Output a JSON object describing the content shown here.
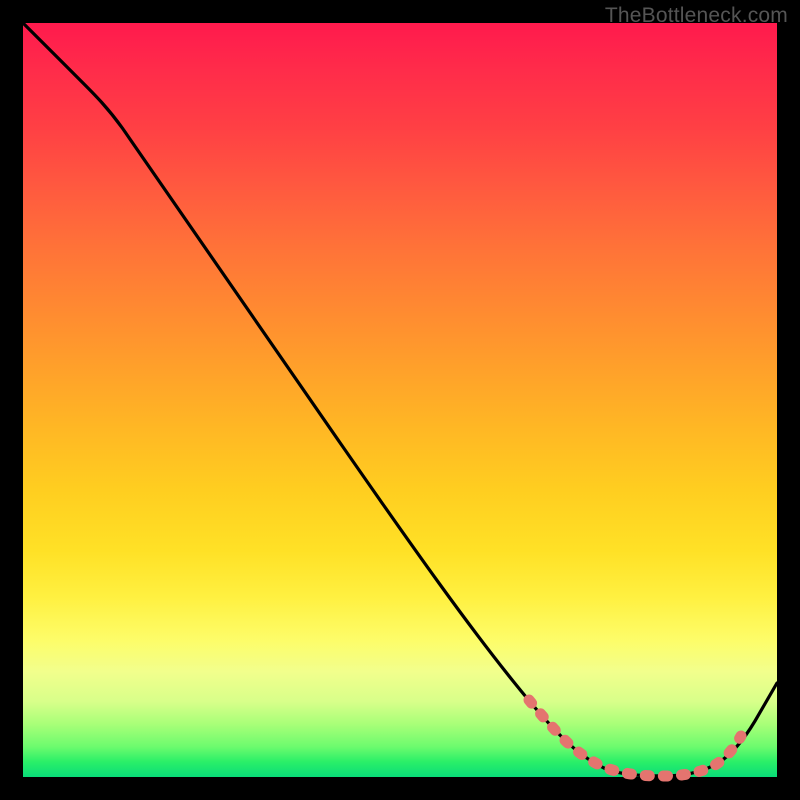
{
  "watermark": "TheBottleneck.com",
  "chart_data": {
    "type": "line",
    "title": "",
    "xlabel": "",
    "ylabel": "",
    "xlim": [
      0,
      100
    ],
    "ylim": [
      0,
      100
    ],
    "grid": false,
    "series": [
      {
        "name": "bottleneck-curve",
        "x": [
          0,
          4,
          8,
          12,
          20,
          30,
          40,
          50,
          58,
          63,
          68,
          72,
          75,
          78,
          82,
          86,
          90,
          94,
          97,
          100
        ],
        "y": [
          100,
          97,
          93,
          89,
          79,
          66,
          53,
          40,
          29,
          22,
          14,
          9,
          5,
          3,
          1,
          1,
          2,
          6,
          13,
          23
        ]
      }
    ],
    "highlight_region": {
      "name": "optimal-zone",
      "x": [
        68,
        71,
        74,
        77,
        80,
        83,
        86,
        89,
        92
      ],
      "y": [
        14,
        10,
        6,
        3,
        1,
        1,
        1,
        3,
        8
      ]
    },
    "colors": {
      "curve": "#000000",
      "highlight": "#e4746f",
      "gradient_top": "#ff1a4d",
      "gradient_bottom": "#09dc79"
    }
  }
}
